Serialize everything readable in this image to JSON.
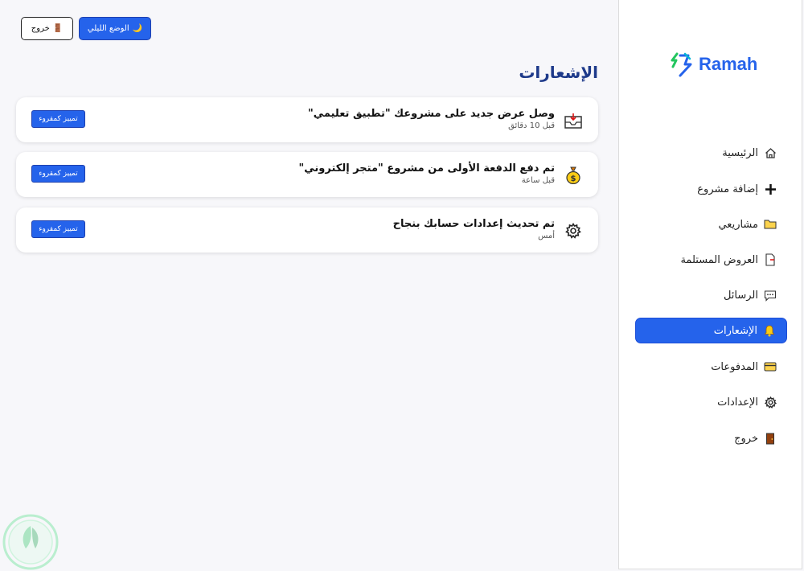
{
  "brand": {
    "name": "Ramah",
    "color": "#2563eb"
  },
  "topbar": {
    "dark_mode_label": "الوضع الليلي",
    "dark_mode_icon": "moon-icon",
    "logout_label": "خروج",
    "logout_icon": "door-icon"
  },
  "page": {
    "title": "الإشعارات"
  },
  "sidebar": {
    "items": [
      {
        "label": "الرئيسية",
        "icon": "home-icon"
      },
      {
        "label": "إضافة مشروع",
        "icon": "plus-icon"
      },
      {
        "label": "مشاريعي",
        "icon": "folder-icon"
      },
      {
        "label": "العروض المستلمة",
        "icon": "document-icon"
      },
      {
        "label": "الرسائل",
        "icon": "chat-icon"
      },
      {
        "label": "الإشعارات",
        "icon": "bell-icon",
        "active": true
      },
      {
        "label": "المدفوعات",
        "icon": "card-icon"
      },
      {
        "label": "الإعدادات",
        "icon": "gear-icon"
      },
      {
        "label": "خروج",
        "icon": "door-icon"
      }
    ]
  },
  "notifications": [
    {
      "title": "وصل عرض جديد على مشروعك \"تطبيق تعليمي\"",
      "time": "قبل 10 دقائق",
      "icon": "inbox-icon",
      "action": "تمييز كمقروء"
    },
    {
      "title": "تم دفع الدفعة الأولى من مشروع \"متجر إلكتروني\"",
      "time": "قبل ساعة",
      "icon": "money-bag-icon",
      "action": "تمييز كمقروء"
    },
    {
      "title": "تم تحديث إعدادات حسابك بنجاح",
      "time": "أمس",
      "icon": "gear-icon",
      "action": "تمييز كمقروء"
    }
  ],
  "colors": {
    "accent": "#2563eb",
    "title": "#1e3a8a",
    "background": "#f7f7fa"
  }
}
